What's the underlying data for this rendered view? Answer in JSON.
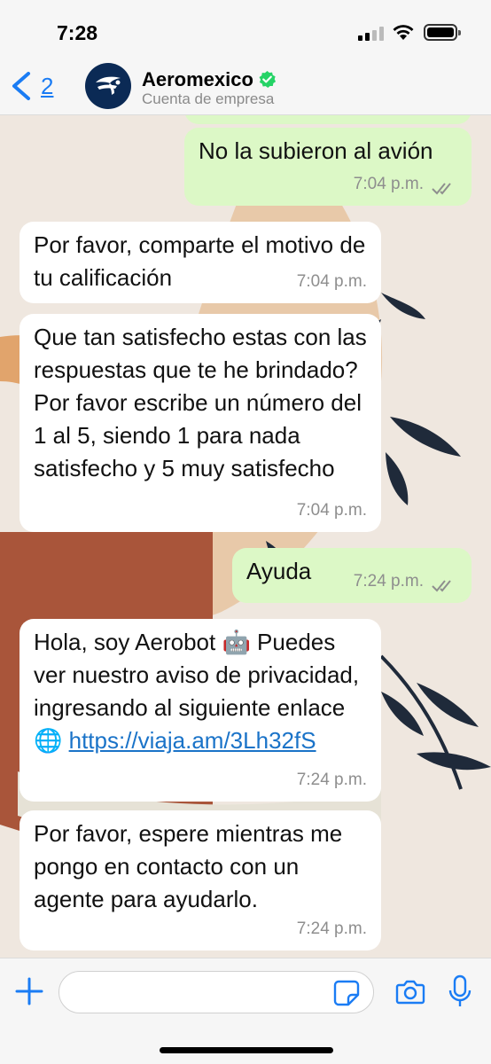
{
  "status": {
    "time": "7:28"
  },
  "header": {
    "back_count": "2",
    "name": "Aeromexico",
    "subtitle": "Cuenta de empresa"
  },
  "messages": [
    {
      "direction": "out",
      "text": "No la subieron al avión",
      "time": "7:04 p.m."
    },
    {
      "direction": "in",
      "text": "Por favor, comparte el motivo de tu calificación",
      "time": "7:04 p.m."
    },
    {
      "direction": "in",
      "text": "Que tan satisfecho estas con las respuestas que te he brindado? Por favor escribe un número del 1 al 5, siendo 1 para nada satisfecho y 5 muy satisfecho",
      "time": "7:04 p.m."
    },
    {
      "direction": "out",
      "text": "Ayuda",
      "time": "7:24 p.m."
    },
    {
      "direction": "in",
      "text": "Hola, soy Aerobot 🤖 Puedes ver nuestro aviso de privacidad, ingresando al siguiente enlace 🌐",
      "link": "https://viaja.am/3Lh32fS",
      "time": "7:24 p.m."
    },
    {
      "direction": "in",
      "text": "Por favor, espere mientras me pongo en contacto con un agente para ayudarlo.",
      "time": "7:24 p.m."
    }
  ],
  "input": {
    "value": ""
  },
  "colors": {
    "accent": "#1a7cf4",
    "outgoing": "#dcf8c6",
    "incoming": "#ffffff",
    "tick": "#8e8e8e",
    "verified": "#25d366"
  }
}
